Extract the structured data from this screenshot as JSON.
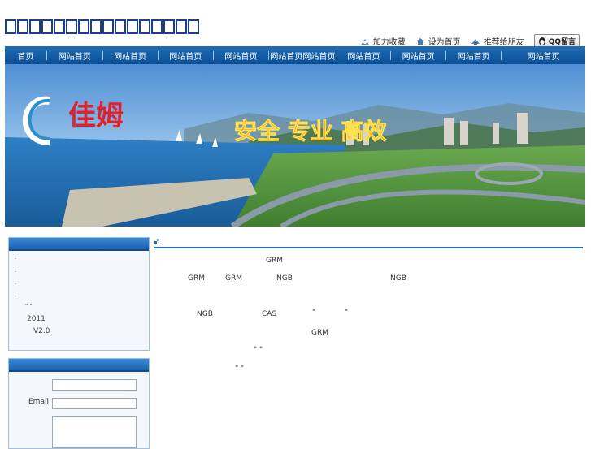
{
  "site": {
    "title_glyph_count": 16
  },
  "top_links": {
    "favorite": "加力收藏",
    "homepage": "设为首页",
    "recommend": "推荐给朋友",
    "qq": "QQ留言"
  },
  "nav": {
    "items": [
      "首页",
      "网站首页",
      "网站首页",
      "网站首页",
      "网站首页",
      "网站首页网站首页",
      "网站首页",
      "网站首页",
      "网站首页",
      "网站首页"
    ]
  },
  "banner": {
    "logo_text": "佳姆",
    "slogan": "安全 专业 高效"
  },
  "sidebar": {
    "lines": [
      "·",
      "·",
      "·",
      "·",
      "\"  \"",
      "2011",
      "V2.0"
    ]
  },
  "form": {
    "email_label": "Email"
  },
  "content": {
    "lines": [
      [
        "GRM"
      ],
      [
        "GRM",
        "GRM",
        "NGB",
        "NGB"
      ],
      [
        "NGB",
        "CAS",
        "\"",
        "\""
      ],
      [
        "GRM"
      ],
      [
        "\" \""
      ],
      [
        "\"  \""
      ]
    ]
  },
  "colors": {
    "nav_bg": "#0c4f96",
    "accent": "#1f6fc0",
    "title_box": "#1a3f8f"
  }
}
